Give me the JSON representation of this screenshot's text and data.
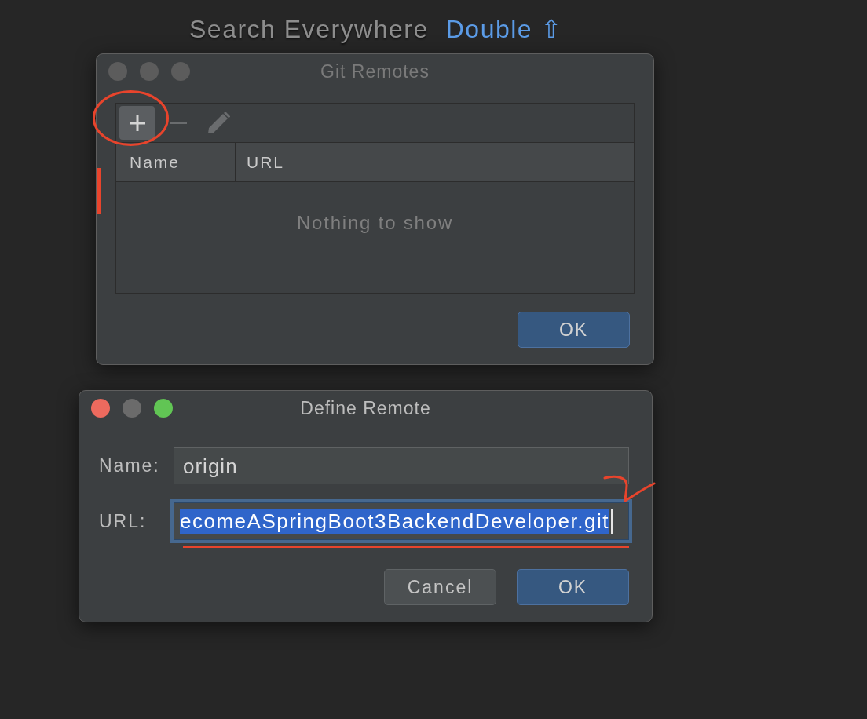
{
  "hint": {
    "label": "Search Everywhere",
    "shortcut": "Double",
    "key": "⇧"
  },
  "git_remotes": {
    "title": "Git Remotes",
    "active": false,
    "toolbar": [
      {
        "kind": "add",
        "hovered": true,
        "disabled": false,
        "circled": true
      },
      {
        "kind": "remove",
        "hovered": false,
        "disabled": true,
        "circled": false
      },
      {
        "kind": "edit",
        "hovered": false,
        "disabled": true,
        "circled": false
      }
    ],
    "table": {
      "columns": [
        "Name",
        "URL"
      ],
      "empty_text": "Nothing to show",
      "side_marked": true
    },
    "buttons": [
      {
        "label": "OK",
        "default": true
      }
    ]
  },
  "define_remote": {
    "title": "Define Remote",
    "active": true,
    "fields": [
      {
        "label": "Name:",
        "value": "origin",
        "focused": false,
        "selected": false,
        "underlined": false,
        "ticked": false
      },
      {
        "label": "URL:",
        "value": "ecomeASpringBoot3BackendDeveloper.git",
        "focused": true,
        "selected": true,
        "underlined": true,
        "ticked": true
      }
    ],
    "buttons": [
      {
        "label": "Cancel",
        "default": false
      },
      {
        "label": "OK",
        "default": true
      }
    ]
  }
}
